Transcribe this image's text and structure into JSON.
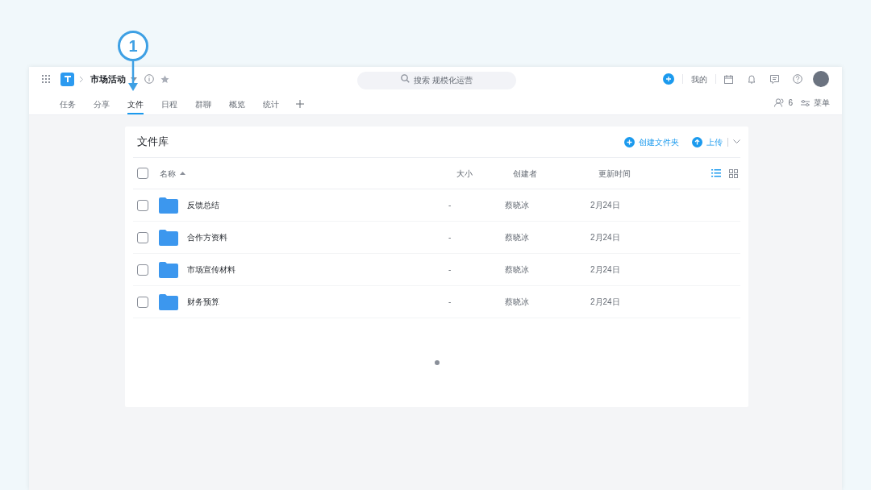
{
  "annotation": {
    "label": "1"
  },
  "header": {
    "project": "市场活动",
    "search": {
      "placeholder": "搜索 规模化运营"
    },
    "mine": "我的"
  },
  "tabs": [
    {
      "label": "任务",
      "selected": false
    },
    {
      "label": "分享",
      "selected": false
    },
    {
      "label": "文件",
      "selected": true
    },
    {
      "label": "日程",
      "selected": false
    },
    {
      "label": "群聊",
      "selected": false
    },
    {
      "label": "概览",
      "selected": false
    },
    {
      "label": "统计",
      "selected": false
    }
  ],
  "members": {
    "count": "6"
  },
  "menu": "菜单",
  "library": {
    "title": "文件库",
    "create_folder": "创建文件夹",
    "upload": "上传",
    "select_all": {
      "checked": false
    },
    "columns": [
      "名称",
      "大小",
      "创建者",
      "更新时间"
    ],
    "view_modes": [
      {
        "kind": "list",
        "selected": true
      },
      {
        "kind": "grid",
        "selected": false
      }
    ],
    "rows": [
      {
        "name": "反馈总结",
        "size": "-",
        "creator": "蔡晓冰",
        "updated": "2月24日",
        "checked": false
      },
      {
        "name": "合作方资料",
        "size": "-",
        "creator": "蔡晓冰",
        "updated": "2月24日",
        "checked": false
      },
      {
        "name": "市场宣传材料",
        "size": "-",
        "creator": "蔡晓冰",
        "updated": "2月24日",
        "checked": false
      },
      {
        "name": "财务预算",
        "size": "-",
        "creator": "蔡晓冰",
        "updated": "2月24日",
        "checked": false
      }
    ]
  }
}
